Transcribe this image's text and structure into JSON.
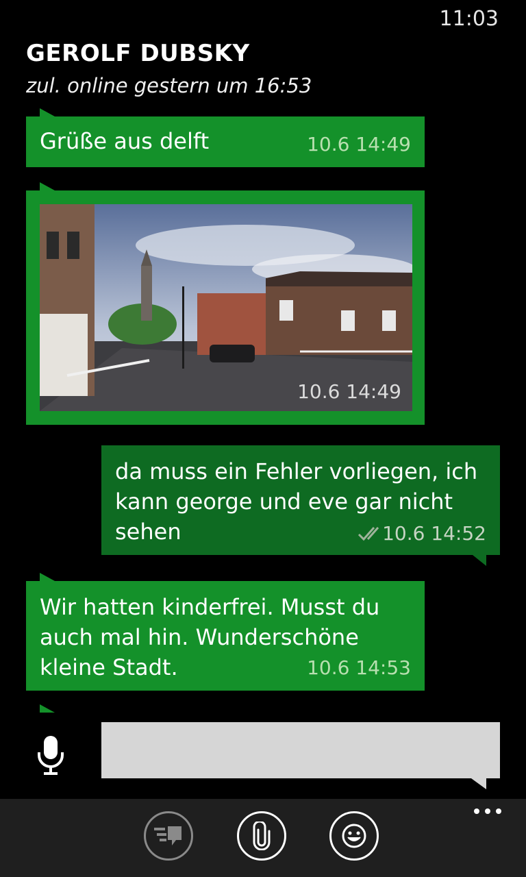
{
  "status_bar": {
    "time": "11:03"
  },
  "header": {
    "contact_name": "GEROLF DUBSKY",
    "last_seen": "zul. online gestern um 16:53"
  },
  "messages": [
    {
      "direction": "incoming",
      "type": "text",
      "text": "Grüße aus delft",
      "time": "10.6 14:49"
    },
    {
      "direction": "incoming",
      "type": "image",
      "time": "10.6 14:49"
    },
    {
      "direction": "outgoing",
      "type": "text",
      "lines": [
        "da muss ein Fehler vorliegen, ich",
        "kann george und eve gar nicht",
        "sehen"
      ],
      "time": "10.6 14:52",
      "delivery_icon": "double-check-icon"
    },
    {
      "direction": "incoming",
      "type": "text",
      "lines": [
        "Wir hatten kinderfrei. Musst du",
        "auch mal hin. Wunderschöne",
        "kleine Stadt."
      ],
      "time": "10.6 14:53"
    }
  ],
  "composer": {
    "placeholder": "",
    "value": ""
  },
  "app_bar": {
    "buttons": [
      "quick-reply-icon",
      "attach-icon",
      "emoji-icon"
    ],
    "more_icon": "ellipsis-icon"
  },
  "colors": {
    "incoming_bubble": "#14912a",
    "outgoing_bubble": "#0e6b22",
    "background": "#000000",
    "app_bar": "#1f1f1f",
    "input": "#d6d6d6"
  }
}
